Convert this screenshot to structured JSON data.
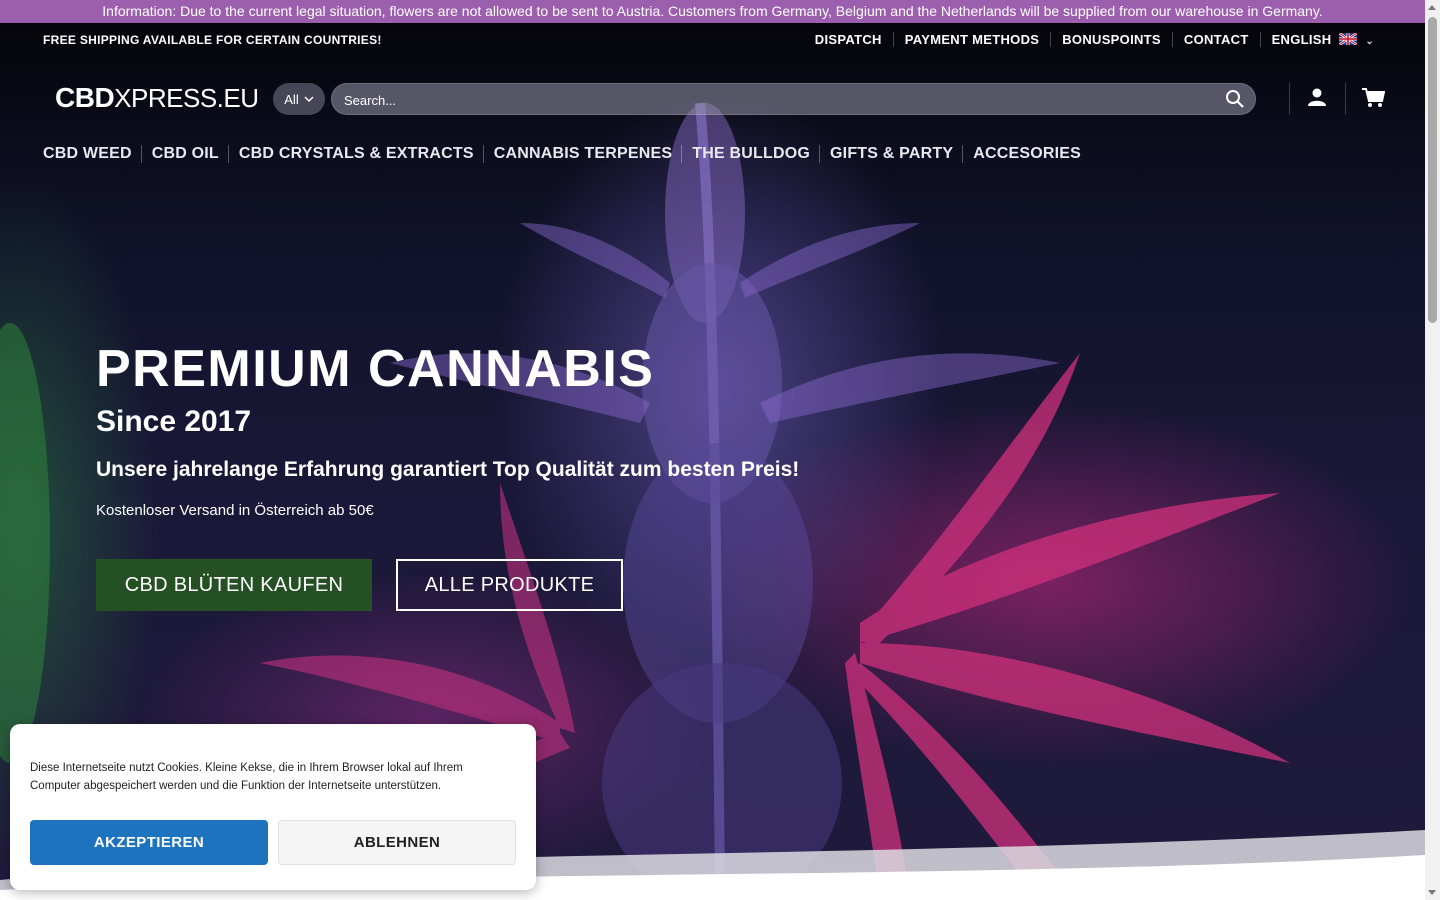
{
  "notice": "Information: Due to the current legal situation, flowers are not allowed to be sent to Austria. Customers from Germany, Belgium and the Netherlands will be supplied from our warehouse in Germany.",
  "topbar": {
    "shipping": "FREE SHIPPING AVAILABLE FOR CERTAIN COUNTRIES!",
    "links": [
      "DISPATCH",
      "PAYMENT METHODS",
      "BONUSPOINTS",
      "CONTACT"
    ],
    "language": "ENGLISH"
  },
  "header": {
    "logo_bold": "CBD",
    "logo_rest": "XPRESS.EU",
    "category_select": "All",
    "search_placeholder": "Search..."
  },
  "nav": [
    "CBD WEED",
    "CBD OIL",
    "CBD CRYSTALS & EXTRACTS",
    "CANNABIS TERPENES",
    "THE BULLDOG",
    "GIFTS & PARTY",
    "ACCESORIES"
  ],
  "hero": {
    "title": "PREMIUM CANNABIS",
    "subtitle": "Since 2017",
    "tagline": "Unsere jahrelange Erfahrung garantiert Top Qualität zum besten Preis!",
    "note": "Kostenloser Versand in Österreich ab 50€",
    "primary_button": "CBD BLÜTEN KAUFEN",
    "secondary_button": "ALLE PRODUKTE"
  },
  "cookie": {
    "text": "Diese Internetseite nutzt Cookies. Kleine Kekse, die in Ihrem Browser lokal auf Ihrem Computer abgespeichert werden und die Funktion der Internetseite unterstützen.",
    "accept": "AKZEPTIEREN",
    "decline": "ABLEHNEN"
  },
  "colors": {
    "notice_bg": "#9b5fae",
    "primary_button": "#245024",
    "accept_button": "#1e73be"
  },
  "icons": [
    "search-icon",
    "user-icon",
    "cart-icon",
    "chevron-down-icon",
    "uk-flag-icon"
  ]
}
